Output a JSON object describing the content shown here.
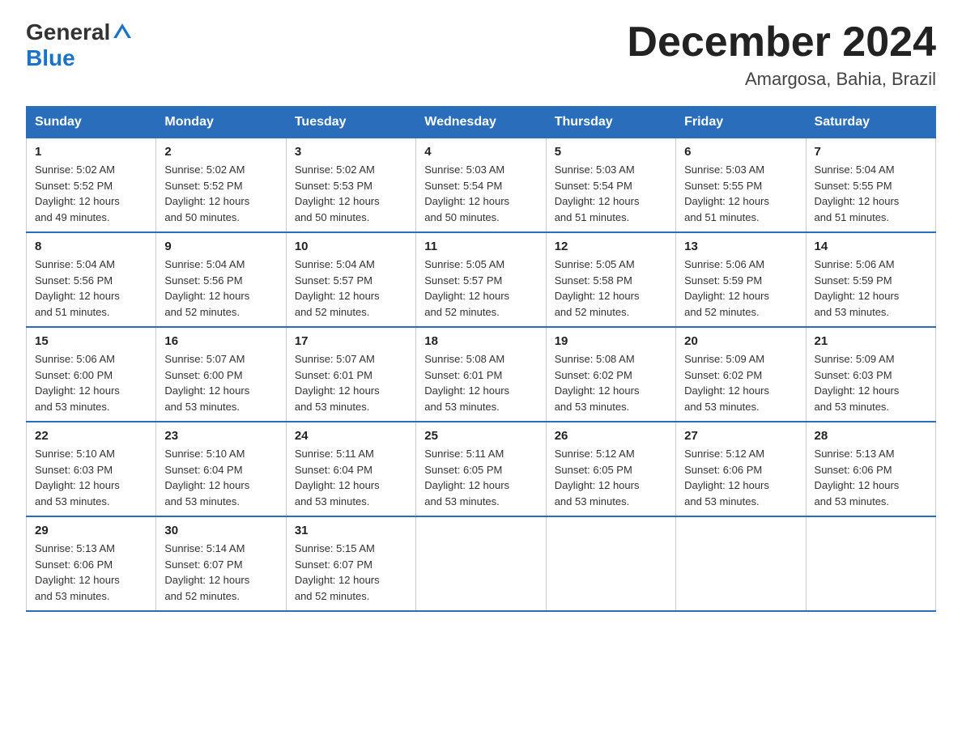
{
  "logo": {
    "general": "General",
    "triangle": "▲",
    "blue": "Blue"
  },
  "title": "December 2024",
  "location": "Amargosa, Bahia, Brazil",
  "days_of_week": [
    "Sunday",
    "Monday",
    "Tuesday",
    "Wednesday",
    "Thursday",
    "Friday",
    "Saturday"
  ],
  "weeks": [
    [
      {
        "day": "1",
        "sunrise": "5:02 AM",
        "sunset": "5:52 PM",
        "daylight": "12 hours and 49 minutes."
      },
      {
        "day": "2",
        "sunrise": "5:02 AM",
        "sunset": "5:52 PM",
        "daylight": "12 hours and 50 minutes."
      },
      {
        "day": "3",
        "sunrise": "5:02 AM",
        "sunset": "5:53 PM",
        "daylight": "12 hours and 50 minutes."
      },
      {
        "day": "4",
        "sunrise": "5:03 AM",
        "sunset": "5:54 PM",
        "daylight": "12 hours and 50 minutes."
      },
      {
        "day": "5",
        "sunrise": "5:03 AM",
        "sunset": "5:54 PM",
        "daylight": "12 hours and 51 minutes."
      },
      {
        "day": "6",
        "sunrise": "5:03 AM",
        "sunset": "5:55 PM",
        "daylight": "12 hours and 51 minutes."
      },
      {
        "day": "7",
        "sunrise": "5:04 AM",
        "sunset": "5:55 PM",
        "daylight": "12 hours and 51 minutes."
      }
    ],
    [
      {
        "day": "8",
        "sunrise": "5:04 AM",
        "sunset": "5:56 PM",
        "daylight": "12 hours and 51 minutes."
      },
      {
        "day": "9",
        "sunrise": "5:04 AM",
        "sunset": "5:56 PM",
        "daylight": "12 hours and 52 minutes."
      },
      {
        "day": "10",
        "sunrise": "5:04 AM",
        "sunset": "5:57 PM",
        "daylight": "12 hours and 52 minutes."
      },
      {
        "day": "11",
        "sunrise": "5:05 AM",
        "sunset": "5:57 PM",
        "daylight": "12 hours and 52 minutes."
      },
      {
        "day": "12",
        "sunrise": "5:05 AM",
        "sunset": "5:58 PM",
        "daylight": "12 hours and 52 minutes."
      },
      {
        "day": "13",
        "sunrise": "5:06 AM",
        "sunset": "5:59 PM",
        "daylight": "12 hours and 52 minutes."
      },
      {
        "day": "14",
        "sunrise": "5:06 AM",
        "sunset": "5:59 PM",
        "daylight": "12 hours and 53 minutes."
      }
    ],
    [
      {
        "day": "15",
        "sunrise": "5:06 AM",
        "sunset": "6:00 PM",
        "daylight": "12 hours and 53 minutes."
      },
      {
        "day": "16",
        "sunrise": "5:07 AM",
        "sunset": "6:00 PM",
        "daylight": "12 hours and 53 minutes."
      },
      {
        "day": "17",
        "sunrise": "5:07 AM",
        "sunset": "6:01 PM",
        "daylight": "12 hours and 53 minutes."
      },
      {
        "day": "18",
        "sunrise": "5:08 AM",
        "sunset": "6:01 PM",
        "daylight": "12 hours and 53 minutes."
      },
      {
        "day": "19",
        "sunrise": "5:08 AM",
        "sunset": "6:02 PM",
        "daylight": "12 hours and 53 minutes."
      },
      {
        "day": "20",
        "sunrise": "5:09 AM",
        "sunset": "6:02 PM",
        "daylight": "12 hours and 53 minutes."
      },
      {
        "day": "21",
        "sunrise": "5:09 AM",
        "sunset": "6:03 PM",
        "daylight": "12 hours and 53 minutes."
      }
    ],
    [
      {
        "day": "22",
        "sunrise": "5:10 AM",
        "sunset": "6:03 PM",
        "daylight": "12 hours and 53 minutes."
      },
      {
        "day": "23",
        "sunrise": "5:10 AM",
        "sunset": "6:04 PM",
        "daylight": "12 hours and 53 minutes."
      },
      {
        "day": "24",
        "sunrise": "5:11 AM",
        "sunset": "6:04 PM",
        "daylight": "12 hours and 53 minutes."
      },
      {
        "day": "25",
        "sunrise": "5:11 AM",
        "sunset": "6:05 PM",
        "daylight": "12 hours and 53 minutes."
      },
      {
        "day": "26",
        "sunrise": "5:12 AM",
        "sunset": "6:05 PM",
        "daylight": "12 hours and 53 minutes."
      },
      {
        "day": "27",
        "sunrise": "5:12 AM",
        "sunset": "6:06 PM",
        "daylight": "12 hours and 53 minutes."
      },
      {
        "day": "28",
        "sunrise": "5:13 AM",
        "sunset": "6:06 PM",
        "daylight": "12 hours and 53 minutes."
      }
    ],
    [
      {
        "day": "29",
        "sunrise": "5:13 AM",
        "sunset": "6:06 PM",
        "daylight": "12 hours and 53 minutes."
      },
      {
        "day": "30",
        "sunrise": "5:14 AM",
        "sunset": "6:07 PM",
        "daylight": "12 hours and 52 minutes."
      },
      {
        "day": "31",
        "sunrise": "5:15 AM",
        "sunset": "6:07 PM",
        "daylight": "12 hours and 52 minutes."
      },
      null,
      null,
      null,
      null
    ]
  ],
  "labels": {
    "sunrise": "Sunrise:",
    "sunset": "Sunset:",
    "daylight": "Daylight:"
  }
}
